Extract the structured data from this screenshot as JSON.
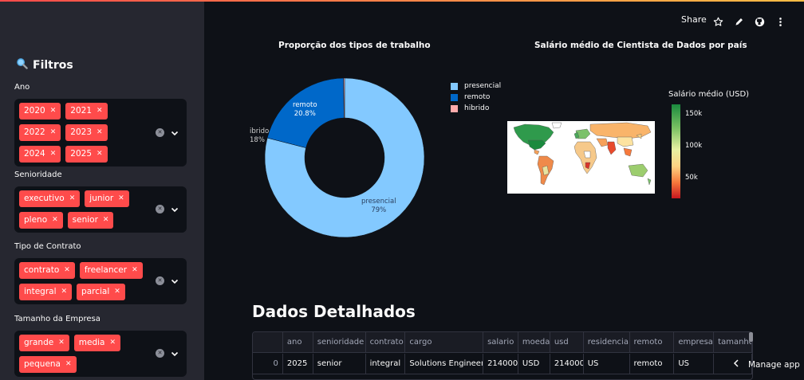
{
  "sidebar": {
    "title": "Filtros",
    "filters": [
      {
        "label": "Ano",
        "tags": [
          "2020",
          "2021",
          "2022",
          "2023",
          "2024",
          "2025"
        ]
      },
      {
        "label": "Senioridade",
        "tags": [
          "executivo",
          "junior",
          "pleno",
          "senior"
        ]
      },
      {
        "label": "Tipo de Contrato",
        "tags": [
          "contrato",
          "freelancer",
          "integral",
          "parcial"
        ]
      },
      {
        "label": "Tamanho da Empresa",
        "tags": [
          "grande",
          "media",
          "pequena"
        ]
      }
    ]
  },
  "header": {
    "share_label": "Share"
  },
  "pie": {
    "title": "Proporção dos tipos de trabalho",
    "legend": [
      "presencial",
      "remoto",
      "hibrido"
    ],
    "labels": {
      "presencial_name": "presencial",
      "presencial_pct": "79%",
      "remoto_name": "remoto",
      "remoto_pct": "20.8%",
      "hibrido_name": "ibrido",
      "hibrido_pct": "18%"
    }
  },
  "map": {
    "title": "Salário médio de Cientista de Dados por país",
    "colorbar_title": "Salário médio (USD)",
    "colorbar_ticks": [
      "150k",
      "100k",
      "50k"
    ]
  },
  "chart_data": {
    "type": "pie",
    "title": "Proporção dos tipos de trabalho",
    "categories": [
      "presencial",
      "remoto",
      "hibrido"
    ],
    "values": [
      79.0,
      20.8,
      0.2
    ],
    "colors": [
      "#83c9ff",
      "#0068c9",
      "#ffabab"
    ],
    "hole": 0.5
  },
  "table_section": {
    "title": "Dados Detalhados",
    "columns": [
      "",
      "ano",
      "senioridade",
      "contrato",
      "cargo",
      "salario",
      "moeda",
      "usd",
      "residencia",
      "remoto",
      "empresa",
      "tamanho_"
    ],
    "rows": [
      [
        "0",
        "2025",
        "senior",
        "integral",
        "Solutions Engineer",
        "214000",
        "USD",
        "214000",
        "US",
        "remoto",
        "US",
        ""
      ]
    ]
  },
  "footer": {
    "manage_label": "Manage app"
  },
  "colors": {
    "tag": "#ff4b4b",
    "sidebar": "#262730",
    "background": "#0e1117"
  }
}
